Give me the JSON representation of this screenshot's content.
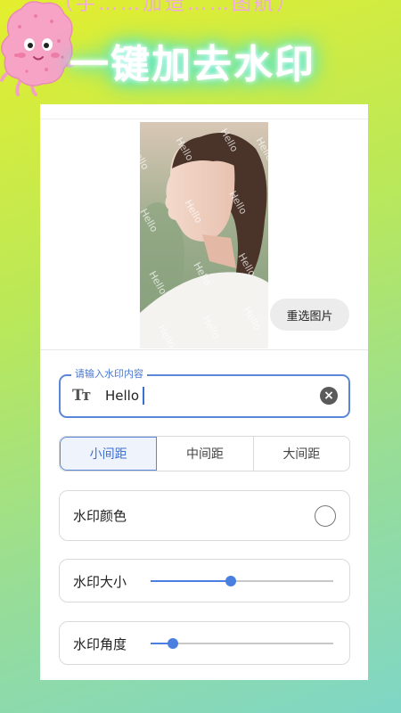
{
  "promo": {
    "headline": "一键加去水印"
  },
  "preview": {
    "watermark_text": "Hello",
    "reselect_label": "重选图片"
  },
  "watermark_input": {
    "legend": "请输入水印内容",
    "value": "Hello",
    "text_icon": "Tт"
  },
  "spacing": {
    "options": [
      "小间距",
      "中间距",
      "大间距"
    ],
    "selected_index": 0
  },
  "settings": {
    "color_label": "水印颜色",
    "size_label": "水印大小",
    "size_value": 0.44,
    "angle_label": "水印角度",
    "angle_value": 0.12
  },
  "colors": {
    "accent": "#4a7fe0",
    "headline_glow": "#39e0d6"
  }
}
